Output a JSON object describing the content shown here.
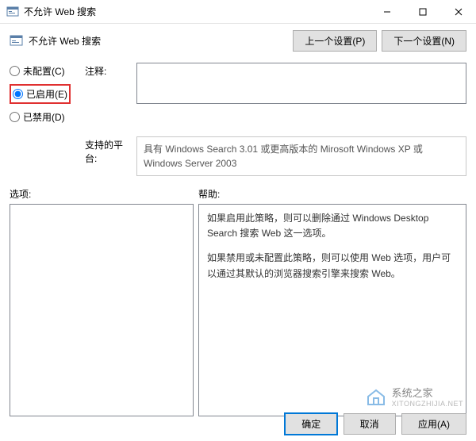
{
  "window": {
    "title": "不允许 Web 搜索",
    "minimize": "–",
    "maximize": "☐",
    "close": "✕"
  },
  "header": {
    "title": "不允许 Web 搜索",
    "prev": "上一个设置(P)",
    "next": "下一个设置(N)"
  },
  "radios": {
    "not_configured": "未配置(C)",
    "enabled": "已启用(E)",
    "disabled": "已禁用(D)",
    "selected": "enabled"
  },
  "labels": {
    "comment": "注释:",
    "platform": "支持的平台:",
    "options": "选项:",
    "help": "帮助:"
  },
  "platform_text": "具有 Windows Search 3.01 或更高版本的 Mirosoft Windows XP 或 Windows Server 2003",
  "help_text": {
    "p1": "如果启用此策略，则可以删除通过 Windows Desktop Search 搜索 Web 这一选项。",
    "p2": "如果禁用或未配置此策略，则可以使用 Web 选项，用户可以通过其默认的浏览器搜索引擎来搜索 Web。"
  },
  "footer": {
    "ok": "确定",
    "cancel": "取消",
    "apply": "应用(A)"
  },
  "watermark": {
    "name": "系统之家",
    "url": "XITONGZHIJIA.NET"
  }
}
